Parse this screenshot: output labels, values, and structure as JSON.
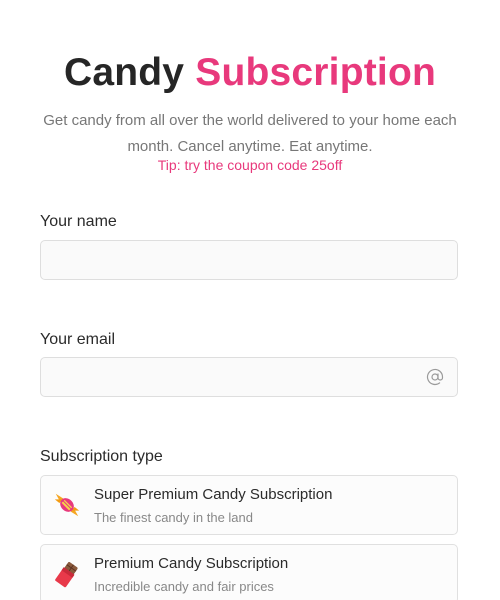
{
  "header": {
    "title_part1": "Candy",
    "title_part2": "Subscription",
    "subtitle": "Get candy from all over the world delivered to your home each month. Cancel anytime. Eat anytime.",
    "tip": "Tip: try the coupon code 25off"
  },
  "form": {
    "name": {
      "label": "Your name",
      "value": "",
      "placeholder": ""
    },
    "email": {
      "label": "Your email",
      "value": "",
      "placeholder": "",
      "icon": "at-sign-icon"
    },
    "subscription": {
      "label": "Subscription type",
      "options": [
        {
          "title": "Super Premium Candy Subscription",
          "description": "The finest candy in the land",
          "icon": "wrapped-candy-icon"
        },
        {
          "title": "Premium Candy Subscription",
          "description": "Incredible candy and fair prices",
          "icon": "chocolate-bar-icon"
        }
      ]
    }
  },
  "colors": {
    "accent": "#e8397c",
    "text": "#2b2b2b",
    "muted": "#777777",
    "border": "#dedede"
  }
}
